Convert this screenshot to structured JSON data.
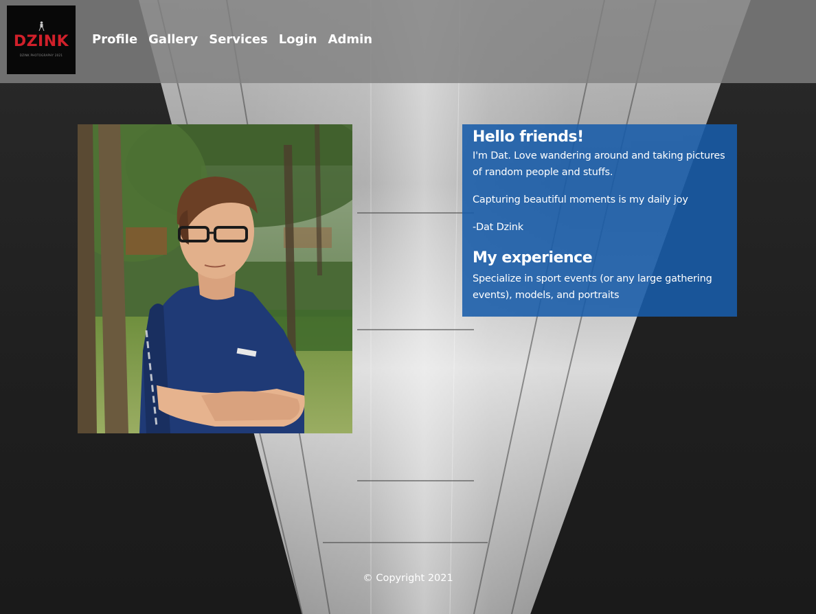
{
  "logo": {
    "text": "DZINK",
    "tagline": "DZINK PHOTOGRAPHY 2021",
    "brand_color": "#d0202a"
  },
  "nav": {
    "items": [
      "Profile",
      "Gallery",
      "Services",
      "Login",
      "Admin"
    ]
  },
  "intro": {
    "heading": "Hello friends!",
    "bio": "I'm Dat. Love wandering around and taking pictures of random people and stuffs.",
    "motto": "Capturing beautiful moments is my daily joy",
    "signature": "-Dat Dzink"
  },
  "experience": {
    "heading": "My experience",
    "text": "Specialize in sport events (or any large gathering events), models, and portraits"
  },
  "footer": {
    "copyright": "© Copyright 2021"
  },
  "colors": {
    "header_overlay": "#808080",
    "panel": "#185caa",
    "background": "#1c1c1c"
  }
}
